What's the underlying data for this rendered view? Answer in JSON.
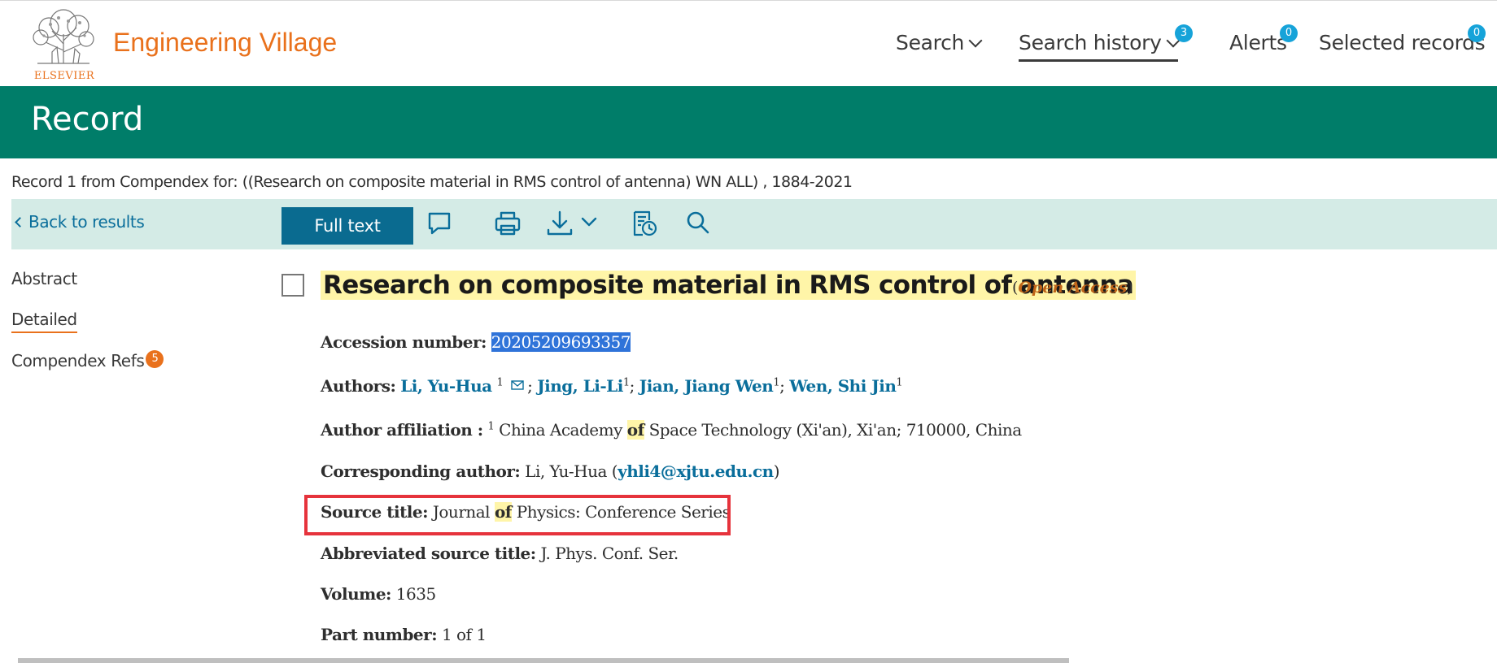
{
  "header": {
    "logo_text": "ELSEVIER",
    "brand": "Engineering Village",
    "nav": {
      "search": "Search",
      "search_history": "Search history",
      "search_history_count": "3",
      "alerts": "Alerts",
      "alerts_count": "0",
      "selected_records": "Selected records",
      "selected_records_count": "0"
    }
  },
  "banner": {
    "title": "Record"
  },
  "record_info": "Record 1 from Compendex for: ((Research on composite material in RMS control of antenna) WN ALL) , 1884-2021",
  "toolbar": {
    "back": "Back to results",
    "full_text": "Full text",
    "icons": [
      "comment-icon",
      "print-icon",
      "download-icon",
      "saved-icon",
      "search-icon"
    ]
  },
  "sidebar": {
    "abstract": "Abstract",
    "detailed": "Detailed",
    "refs": "Compendex Refs",
    "refs_count": "5"
  },
  "record": {
    "title": "Research on composite material in RMS control of antenna",
    "open_access": "Open Access",
    "accession_label": "Accession number:",
    "accession_value": "20205209693357",
    "authors_label": "Authors:",
    "authors": [
      {
        "name": "Li, Yu-Hua",
        "aff": "1"
      },
      {
        "name": "Jing, Li-Li",
        "aff": "1"
      },
      {
        "name": "Jian, Jiang Wen",
        "aff": "1"
      },
      {
        "name": "Wen, Shi Jin",
        "aff": "1"
      }
    ],
    "affiliation_label": "Author affiliation :",
    "affiliation_num": "1",
    "affiliation_pre": "China Academy",
    "affiliation_hl": "of",
    "affiliation_post": "Space Technology (Xi'an), Xi'an; 710000, China",
    "corresponding_label": "Corresponding author:",
    "corresponding_name": "Li, Yu-Hua",
    "corresponding_email": "yhli4@xjtu.edu.cn",
    "source_label": "Source title:",
    "source_pre": "Journal",
    "source_hl": "of",
    "source_post": "Physics: Conference Series",
    "abbr_label": "Abbreviated source title:",
    "abbr_value": "J. Phys. Conf. Ser.",
    "volume_label": "Volume:",
    "volume_value": "1635",
    "part_label": "Part number:",
    "part_value": "1 of 1"
  },
  "colors": {
    "brand_orange": "#e9711c",
    "banner_green": "#007d69",
    "toolbar_bg": "#d4ebe6",
    "button_blue": "#0a6b90",
    "link_blue": "#0a6e9b",
    "badge_blue": "#16a3d9",
    "highlight": "#fff5a8",
    "red_box": "#e6333c"
  }
}
